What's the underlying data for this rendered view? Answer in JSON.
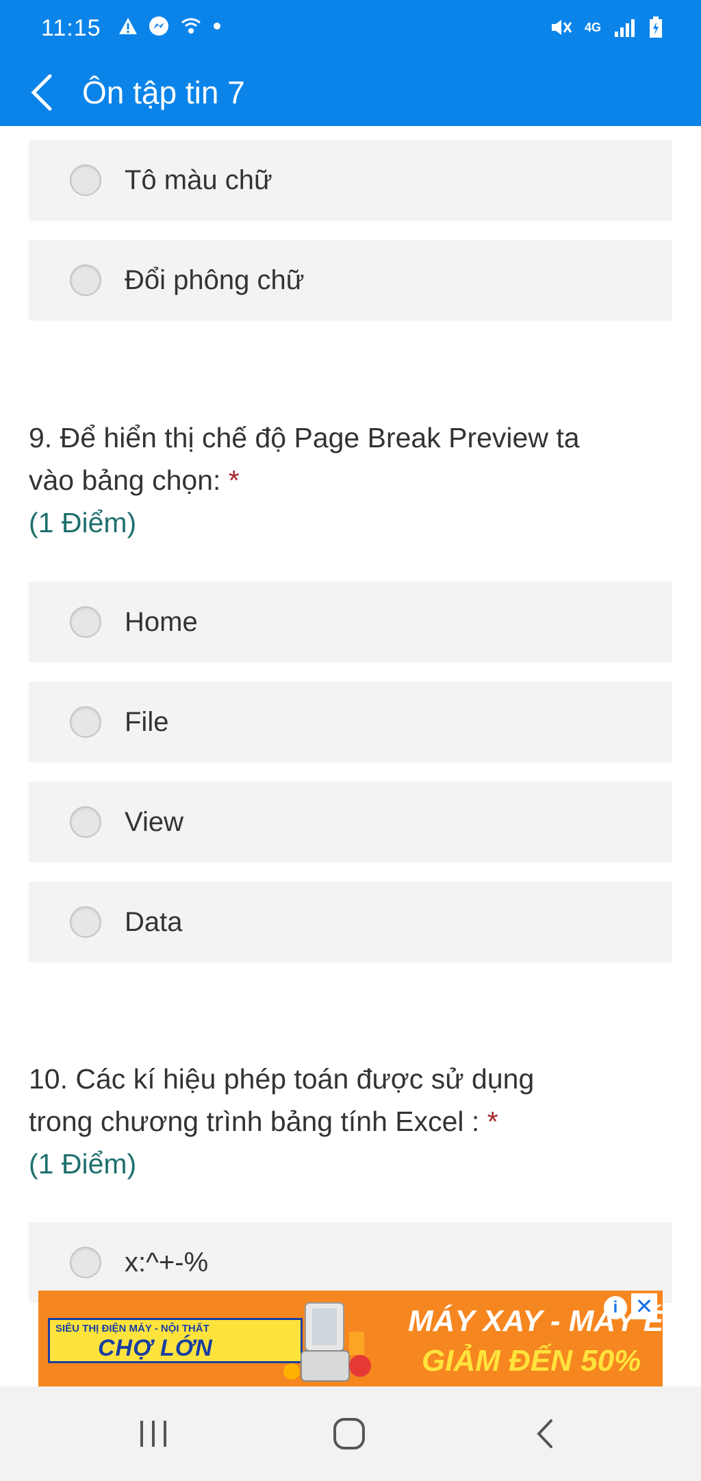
{
  "status_bar": {
    "time": "11:15",
    "left_icons": [
      "warning-icon",
      "messenger-icon",
      "vowifi-icon",
      "dot-icon"
    ],
    "right_icons": [
      "mute-icon",
      "4g-icon",
      "signal-icon",
      "battery-icon"
    ],
    "network_label": "4G"
  },
  "app_bar": {
    "title": "Ôn tập tin 7",
    "color": "#0b84ea"
  },
  "options_top": [
    {
      "label": "Tô màu chữ"
    },
    {
      "label": "Đổi phông chữ"
    }
  ],
  "question9": {
    "line1": "9. Để hiển thị chế độ Page Break Preview ta",
    "line2": "vào bảng chọn: ",
    "required_mark": "*",
    "points": "(1 Điểm)",
    "options": [
      {
        "label": "Home"
      },
      {
        "label": "File"
      },
      {
        "label": "View"
      },
      {
        "label": "Data"
      }
    ]
  },
  "question10": {
    "line1": "10. Các kí hiệu phép toán được sử dụng",
    "line2": "trong chương trình bảng tính Excel : ",
    "required_mark": "*",
    "points": "(1 Điểm)",
    "options": [
      {
        "label": "x:^+-%"
      }
    ]
  },
  "ad": {
    "small_text": "SIÊU THỊ ĐIỆN MÁY - NỘI THẤT",
    "brand": "CHỢ LỚN",
    "headline1": "MÁY XAY - MÁY ÉP",
    "headline2": "GIẢM ĐẾN 50%",
    "info_glyph": "i",
    "close_glyph": "✕"
  },
  "nav_bar": {
    "buttons": [
      "recent-apps",
      "home",
      "back"
    ]
  }
}
